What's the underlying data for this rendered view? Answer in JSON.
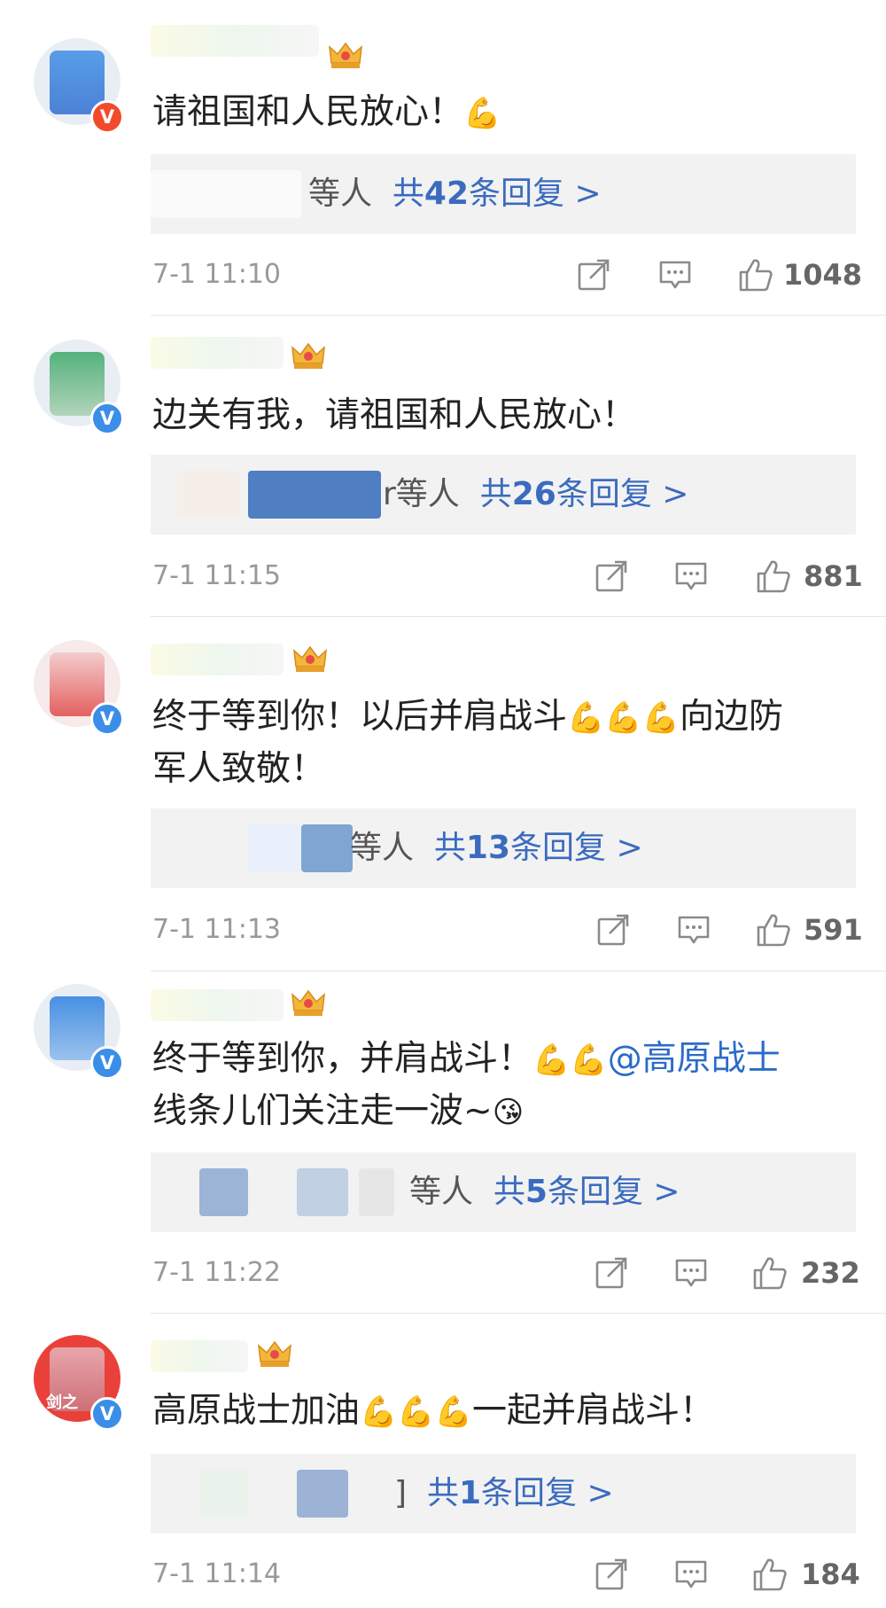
{
  "comments": [
    {
      "text": "请祖国和人民放心！",
      "emoji_after": "💪",
      "reply": {
        "suffix": "等人",
        "prefix": "共",
        "count": "42",
        "unit": "条回复 >"
      },
      "time": "7-1 11:10",
      "likes": "1048",
      "verify": "red",
      "crown_level": "6"
    },
    {
      "text": "边关有我，请祖国和人民放心！",
      "reply": {
        "suffix": "r等人",
        "prefix": "共",
        "count": "26",
        "unit": "条回复 >"
      },
      "time": "7-1 11:15",
      "likes": "881",
      "verify": "blue",
      "crown_level": "6"
    },
    {
      "text_part1": "终于等到你！以后并肩战斗",
      "emojis": "💪💪💪",
      "text_part2": "向边防",
      "text_line2": "军人致敬！",
      "reply": {
        "suffix": "等人",
        "prefix": "共",
        "count": "13",
        "unit": "条回复 >"
      },
      "time": "7-1 11:13",
      "likes": "591",
      "verify": "blue",
      "crown_level": "5"
    },
    {
      "text_part1": "终于等到你，并肩战斗！",
      "emojis": "💪💪",
      "mention": "@高原战士",
      "text_line2": "线条儿们关注走一波~",
      "emoji_line2": "😘",
      "reply": {
        "suffix": "等人",
        "prefix": "共",
        "count": "5",
        "unit": "条回复 >"
      },
      "time": "7-1 11:22",
      "likes": "232",
      "verify": "blue",
      "crown_level": "5"
    },
    {
      "text_part1": "高原战士加油",
      "emojis": "💪💪💪",
      "text_part2": "一起并肩战斗！",
      "reply": {
        "suffix": "]",
        "prefix": "共",
        "count": "1",
        "unit": "条回复 >"
      },
      "time": "7-1 11:14",
      "likes": "184",
      "verify": "blue",
      "avatar_text": "剑之"
    }
  ],
  "icons": {
    "share": "share-icon",
    "comment": "comment-icon",
    "like": "thumbs-up-icon",
    "crown": "crown-icon",
    "verify": "verified-v-icon"
  },
  "colors": {
    "link": "#3b6bbf",
    "meta": "#999999",
    "reply_bg": "#f2f2f2",
    "verify_blue": "#3b8ee8",
    "verify_red": "#f24a2b"
  }
}
